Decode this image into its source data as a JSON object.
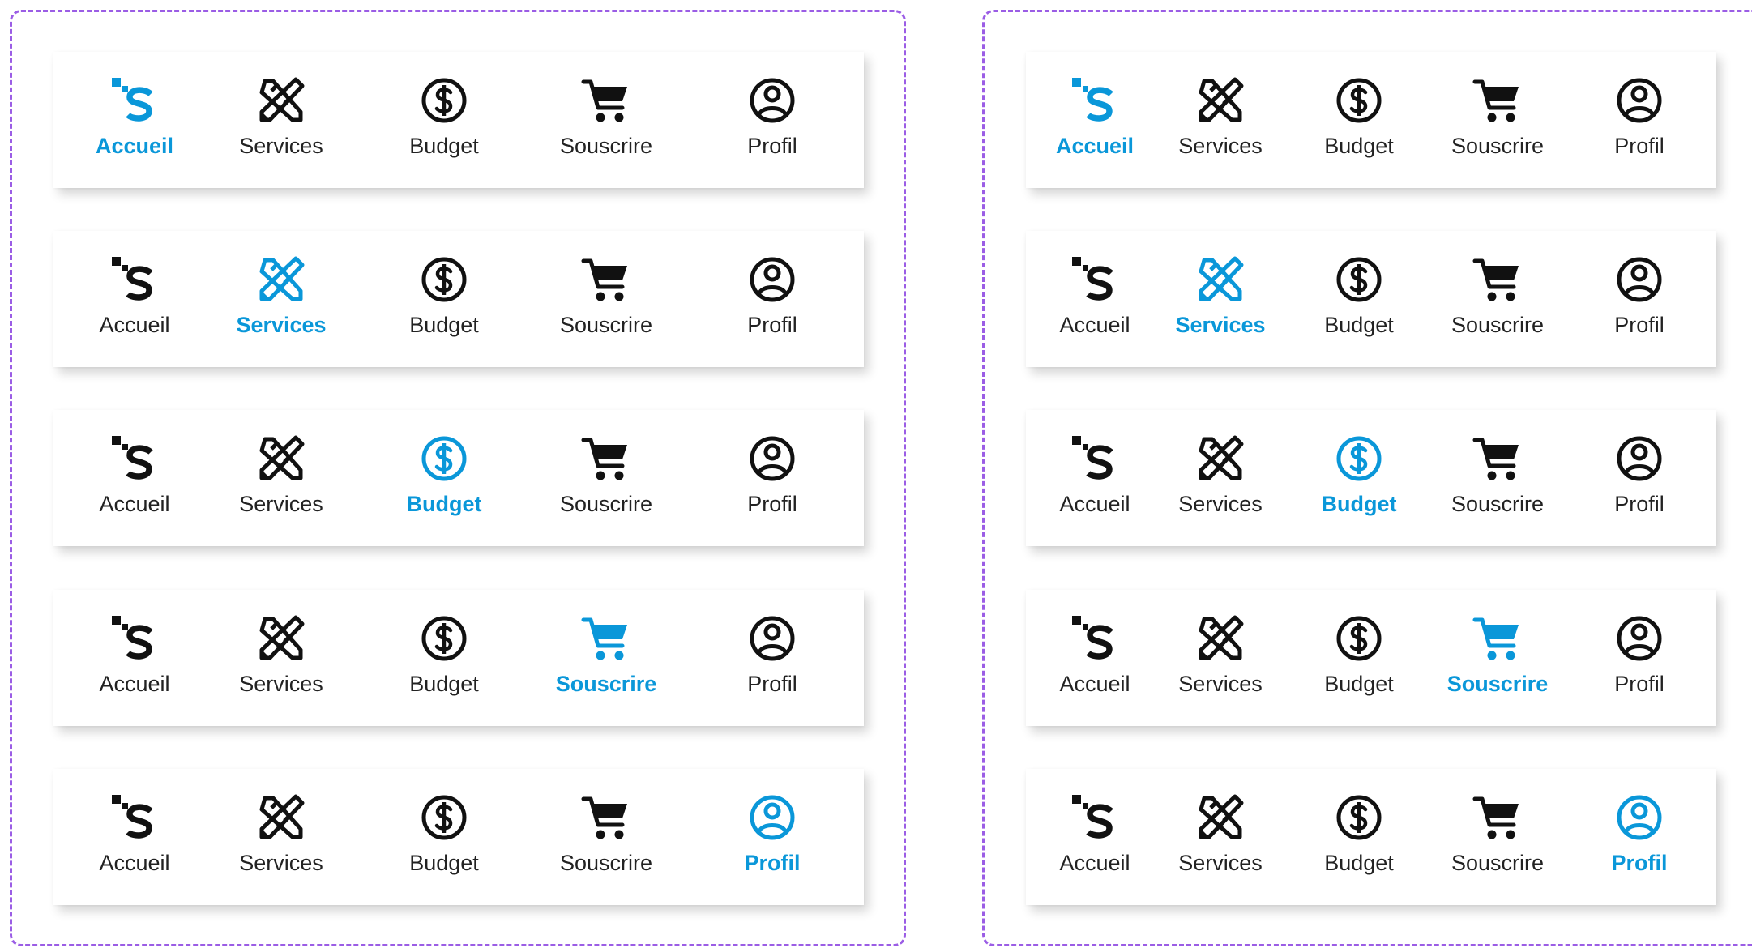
{
  "accent_color": "#0a97d9",
  "inactive_color": "#111111",
  "border_color": "#9b5de5",
  "groups": [
    {
      "variants": [
        {
          "active": 0,
          "items": [
            {
              "label": "Accueil",
              "icon": "logo-s-icon"
            },
            {
              "label": "Services",
              "icon": "tools-icon"
            },
            {
              "label": "Budget",
              "icon": "dollar-circle-icon"
            },
            {
              "label": "Souscrire",
              "icon": "cart-icon"
            },
            {
              "label": "Profil",
              "icon": "user-circle-icon"
            }
          ]
        },
        {
          "active": 1,
          "items": [
            {
              "label": "Accueil",
              "icon": "logo-s-icon"
            },
            {
              "label": "Services",
              "icon": "tools-icon"
            },
            {
              "label": "Budget",
              "icon": "dollar-circle-icon"
            },
            {
              "label": "Souscrire",
              "icon": "cart-icon"
            },
            {
              "label": "Profil",
              "icon": "user-circle-icon"
            }
          ]
        },
        {
          "active": 2,
          "items": [
            {
              "label": "Accueil",
              "icon": "logo-s-icon"
            },
            {
              "label": "Services",
              "icon": "tools-icon"
            },
            {
              "label": "Budget",
              "icon": "dollar-circle-icon"
            },
            {
              "label": "Souscrire",
              "icon": "cart-icon"
            },
            {
              "label": "Profil",
              "icon": "user-circle-icon"
            }
          ]
        },
        {
          "active": 3,
          "items": [
            {
              "label": "Accueil",
              "icon": "logo-s-icon"
            },
            {
              "label": "Services",
              "icon": "tools-icon"
            },
            {
              "label": "Budget",
              "icon": "dollar-circle-icon"
            },
            {
              "label": "Souscrire",
              "icon": "cart-icon"
            },
            {
              "label": "Profil",
              "icon": "user-circle-icon"
            }
          ]
        },
        {
          "active": 4,
          "items": [
            {
              "label": "Accueil",
              "icon": "logo-s-icon"
            },
            {
              "label": "Services",
              "icon": "tools-icon"
            },
            {
              "label": "Budget",
              "icon": "dollar-circle-icon"
            },
            {
              "label": "Souscrire",
              "icon": "cart-icon"
            },
            {
              "label": "Profil",
              "icon": "user-circle-icon"
            }
          ]
        }
      ]
    },
    {
      "variants": [
        {
          "active": 0,
          "items": [
            {
              "label": "Accueil",
              "icon": "logo-s-icon"
            },
            {
              "label": "Services",
              "icon": "tools-icon"
            },
            {
              "label": "Budget",
              "icon": "dollar-circle-icon"
            },
            {
              "label": "Souscrire",
              "icon": "cart-icon"
            },
            {
              "label": "Profil",
              "icon": "user-circle-icon"
            }
          ]
        },
        {
          "active": 1,
          "items": [
            {
              "label": "Accueil",
              "icon": "logo-s-icon"
            },
            {
              "label": "Services",
              "icon": "tools-icon"
            },
            {
              "label": "Budget",
              "icon": "dollar-circle-icon"
            },
            {
              "label": "Souscrire",
              "icon": "cart-icon"
            },
            {
              "label": "Profil",
              "icon": "user-circle-icon"
            }
          ]
        },
        {
          "active": 2,
          "items": [
            {
              "label": "Accueil",
              "icon": "logo-s-icon"
            },
            {
              "label": "Services",
              "icon": "tools-icon"
            },
            {
              "label": "Budget",
              "icon": "dollar-circle-icon"
            },
            {
              "label": "Souscrire",
              "icon": "cart-icon"
            },
            {
              "label": "Profil",
              "icon": "user-circle-icon"
            }
          ]
        },
        {
          "active": 3,
          "items": [
            {
              "label": "Accueil",
              "icon": "logo-s-icon"
            },
            {
              "label": "Services",
              "icon": "tools-icon"
            },
            {
              "label": "Budget",
              "icon": "dollar-circle-icon"
            },
            {
              "label": "Souscrire",
              "icon": "cart-icon"
            },
            {
              "label": "Profil",
              "icon": "user-circle-icon"
            }
          ]
        },
        {
          "active": 4,
          "items": [
            {
              "label": "Accueil",
              "icon": "logo-s-icon"
            },
            {
              "label": "Services",
              "icon": "tools-icon"
            },
            {
              "label": "Budget",
              "icon": "dollar-circle-icon"
            },
            {
              "label": "Souscrire",
              "icon": "cart-icon"
            },
            {
              "label": "Profil",
              "icon": "user-circle-icon"
            }
          ]
        }
      ]
    }
  ]
}
